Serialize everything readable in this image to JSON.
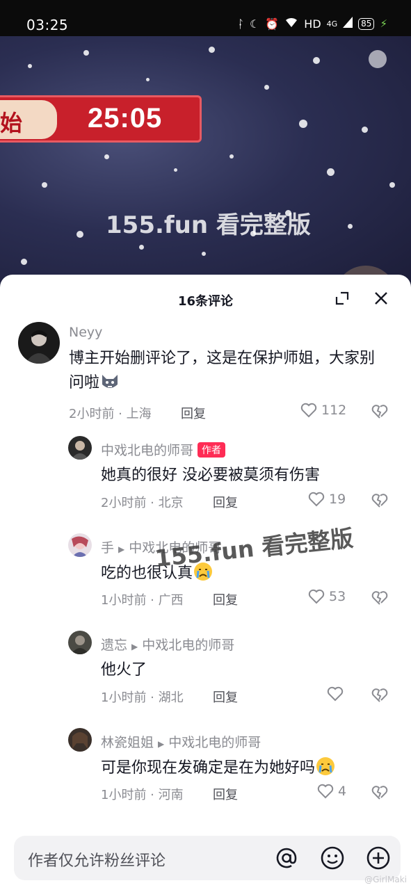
{
  "status_bar": {
    "time": "03:25",
    "network": "HD",
    "signal": "4G",
    "battery": "85"
  },
  "video": {
    "banner_left_text": "始",
    "banner_time": "25:05",
    "watermark": "155.fun 看完整版"
  },
  "sheet": {
    "title": "16条评论"
  },
  "comments": [
    {
      "user": "Neyy",
      "text": "博主开始删评论了，这是在保护师姐，大家别问啦",
      "time_location": "2小时前 · 上海",
      "reply_label": "回复",
      "likes": "112"
    },
    {
      "user": "中戏北电的师哥",
      "badge": "作者",
      "text": "她真的很好 没必要被莫须有伤害",
      "time_location": "2小时前 · 北京",
      "reply_label": "回复",
      "likes": "19"
    },
    {
      "user": "手",
      "reply_to": "中戏北电的师哥",
      "text": "吃的也很认真",
      "time_location": "1小时前 · 广西",
      "reply_label": "回复",
      "likes": "53"
    },
    {
      "user": "遗忘",
      "reply_to": "中戏北电的师哥",
      "text": "他火了",
      "time_location": "1小时前 · 湖北",
      "reply_label": "回复",
      "likes": ""
    },
    {
      "user": "林瓷姐姐",
      "reply_to": "中戏北电的师哥",
      "text": "可是你现在发确定是在为她好吗",
      "time_location": "1小时前 · 河南",
      "reply_label": "回复",
      "likes": "4"
    }
  ],
  "overlay_watermark": "155.fun 看完整版",
  "input": {
    "placeholder": "作者仅允许粉丝评论"
  },
  "corner_watermark": "@GirlMaki",
  "colors": {
    "accent": "#fe2c55",
    "muted": "#8a8b91",
    "text": "#161823"
  }
}
